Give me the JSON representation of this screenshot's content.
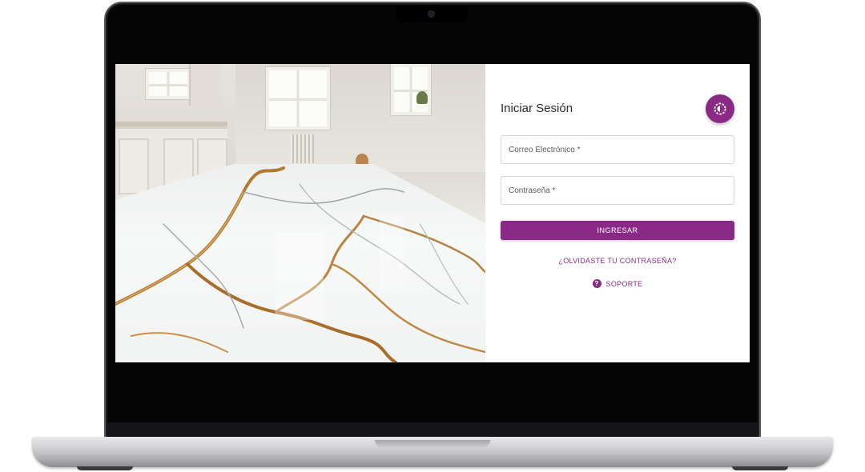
{
  "login": {
    "title": "Iniciar Sesión",
    "email_placeholder": "Correo Electrónico *",
    "password_placeholder": "Contraseña *",
    "submit_label": "INGRESAR",
    "forgot_label": "¿OLVIDASTE TU CONTRASEÑA?",
    "support_label": "SOPORTE",
    "support_icon_glyph": "?"
  },
  "icons": {
    "theme_toggle": "brightness-icon",
    "support": "help-circle-icon"
  },
  "colors": {
    "accent": "#8a2a86",
    "laptop_bezel": "#050505",
    "laptop_base": "#d2d2d5"
  }
}
